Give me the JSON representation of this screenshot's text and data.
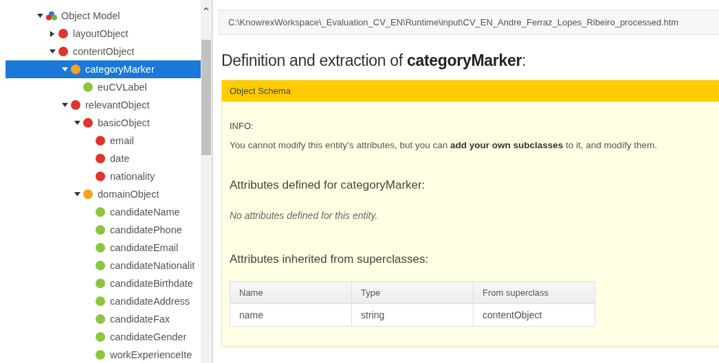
{
  "tree": [
    {
      "label": "Object Model",
      "kind": "model",
      "expanded": true,
      "selected": false,
      "children": [
        {
          "label": "layoutObject",
          "kind": "entity",
          "color": "#e0352b",
          "expanded": false,
          "selected": false
        },
        {
          "label": "contentObject",
          "kind": "entity",
          "color": "#e0352b",
          "expanded": true,
          "selected": false,
          "children": [
            {
              "label": "categoryMarker",
              "kind": "entity",
              "color": "#f7a520",
              "expanded": true,
              "selected": true,
              "children": [
                {
                  "label": "euCVLabel",
                  "kind": "entity",
                  "color": "#8cc63f",
                  "selected": false
                }
              ]
            },
            {
              "label": "relevantObject",
              "kind": "entity",
              "color": "#e0352b",
              "expanded": true,
              "selected": false,
              "children": [
                {
                  "label": "basicObject",
                  "kind": "entity",
                  "color": "#e0352b",
                  "expanded": true,
                  "selected": false,
                  "children": [
                    {
                      "label": "email",
                      "kind": "entity",
                      "color": "#e0352b",
                      "selected": false
                    },
                    {
                      "label": "date",
                      "kind": "entity",
                      "color": "#e0352b",
                      "selected": false
                    },
                    {
                      "label": "nationality",
                      "kind": "entity",
                      "color": "#e0352b",
                      "selected": false
                    }
                  ]
                },
                {
                  "label": "domainObject",
                  "kind": "entity",
                  "color": "#f7a520",
                  "expanded": true,
                  "selected": false,
                  "children": [
                    {
                      "label": "candidateName",
                      "kind": "entity",
                      "color": "#8cc63f",
                      "selected": false
                    },
                    {
                      "label": "candidatePhone",
                      "kind": "entity",
                      "color": "#8cc63f",
                      "selected": false
                    },
                    {
                      "label": "candidateEmail",
                      "kind": "entity",
                      "color": "#8cc63f",
                      "selected": false
                    },
                    {
                      "label": "candidateNationalit",
                      "kind": "entity",
                      "color": "#8cc63f",
                      "selected": false
                    },
                    {
                      "label": "candidateBirthdate",
                      "kind": "entity",
                      "color": "#8cc63f",
                      "selected": false
                    },
                    {
                      "label": "candidateAddress",
                      "kind": "entity",
                      "color": "#8cc63f",
                      "selected": false
                    },
                    {
                      "label": "candidateFax",
                      "kind": "entity",
                      "color": "#8cc63f",
                      "selected": false
                    },
                    {
                      "label": "candidateGender",
                      "kind": "entity",
                      "color": "#8cc63f",
                      "selected": false
                    },
                    {
                      "label": "workExperienceIte",
                      "kind": "entity",
                      "color": "#8cc63f",
                      "selected": false
                    }
                  ]
                }
              ]
            }
          ]
        }
      ]
    }
  ],
  "path": "C:\\KnowrexWorkspace\\_Evaluation_CV_EN\\Runtime\\input\\CV_EN_Andre_Ferraz_Lopes_Ribeiro_processed.htm",
  "heading": "Definition and extraction of **categoryMarker**:",
  "panel": {
    "title": "Object Schema",
    "info_label": "INFO:",
    "info_text": "You cannot modify this entity's attributes, but you can **add your own subclasses** to it, and modify them.",
    "defined_heading": "Attributes defined for categoryMarker:",
    "defined_empty": "No attributes defined for this entity.",
    "inherited_heading": "Attributes inherited from superclasses:",
    "table": {
      "columns": [
        "Name",
        "Type",
        "From superclass"
      ],
      "rows": [
        [
          "name",
          "string",
          "contentObject"
        ]
      ]
    }
  }
}
